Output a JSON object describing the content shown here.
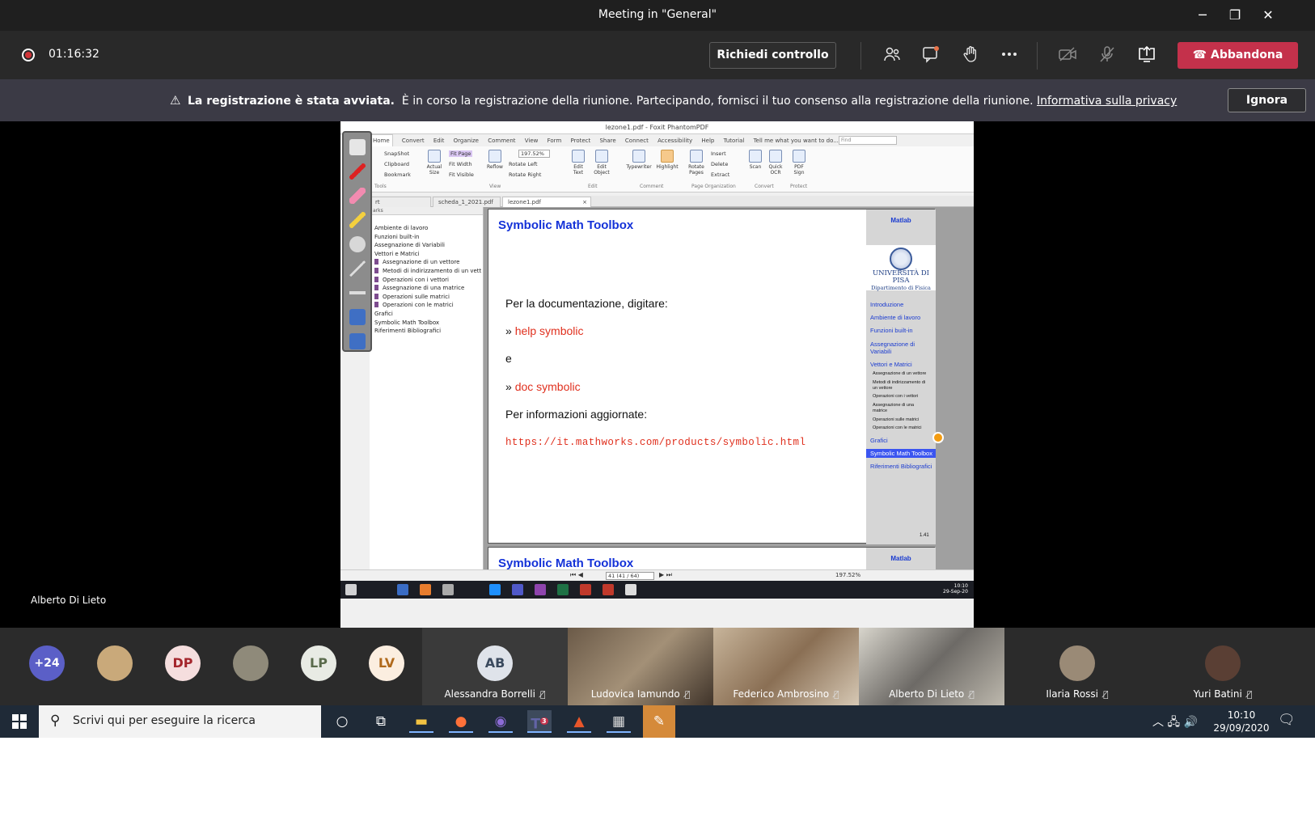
{
  "window": {
    "title": "Meeting in \"General\"",
    "minimize": "─",
    "maximize": "❐",
    "close": "✕"
  },
  "callbar": {
    "timer": "01:16:32",
    "request_control": "Richiedi controllo",
    "leave": "Abbandona"
  },
  "banner": {
    "bold": "La registrazione è stata avviata.",
    "text": "È in corso la registrazione della riunione. Partecipando, fornisci il tuo consenso alla registrazione della riunione.",
    "link": "Informativa sulla privacy",
    "dismiss": "Ignora"
  },
  "stage": {
    "presenter_name": "Alberto Di Lieto"
  },
  "pdf_app": {
    "title": "lezone1.pdf - Foxit PhantomPDF",
    "tabs": [
      "Home",
      "Convert",
      "Edit",
      "Organize",
      "Comment",
      "View",
      "Form",
      "Protect",
      "Share",
      "Connect",
      "Accessibility",
      "Help",
      "Tutorial",
      "Tell me what you want to do..."
    ],
    "find_placeholder": "Find",
    "ribbon_small": {
      "snapshot": "SnapShot",
      "clipboard": "Clipboard",
      "bookmark": "Bookmark",
      "fit_page": "Fit Page",
      "fit_width": "Fit Width",
      "fit_visible": "Fit Visible",
      "zoom": "197.52%",
      "rotate_left": "Rotate Left",
      "rotate_right": "Rotate Right",
      "insert": "Insert",
      "delete": "Delete",
      "extract": "Extract"
    },
    "ribbon_buttons": {
      "actual_size": "Actual Size",
      "reflow": "Reflow",
      "edit_text": "Edit Text",
      "edit_object": "Edit Object",
      "typewriter": "Typewriter",
      "highlight": "Highlight",
      "rotate_pages": "Rotate Pages",
      "scan": "Scan",
      "quick_ocr": "Quick OCR",
      "pdf_sign": "PDF Sign"
    },
    "ribbon_groups": {
      "tools": "Tools",
      "view": "View",
      "edit": "Edit",
      "comment": "Comment",
      "page_org": "Page Organization",
      "convert": "Convert",
      "protect": "Protect"
    },
    "doc_tabs": [
      "rt",
      "scheda_1_2021.pdf",
      "lezone1.pdf"
    ],
    "bookmarks_header": "arks",
    "bookmarks": [
      {
        "label": "Ambiente di lavoro",
        "sub": false
      },
      {
        "label": "Funzioni built-in",
        "sub": false
      },
      {
        "label": "Assegnazione di Variabili",
        "sub": false
      },
      {
        "label": "Vettori e Matrici",
        "sub": false
      },
      {
        "label": "Assegnazione di un vettore",
        "sub": true
      },
      {
        "label": "Metodi di indirizzamento di un vett",
        "sub": true
      },
      {
        "label": "Operazioni con i vettori",
        "sub": true
      },
      {
        "label": "Assegnazione di una matrice",
        "sub": true
      },
      {
        "label": "Operazioni sulle matrici",
        "sub": true
      },
      {
        "label": "Operazioni con le matrici",
        "sub": true
      },
      {
        "label": "Grafici",
        "sub": false
      },
      {
        "label": "Symbolic Math Toolbox",
        "sub": false
      },
      {
        "label": "Riferimenti Bibliografici",
        "sub": false
      }
    ],
    "page": {
      "title": "Symbolic Math Toolbox",
      "line1": "Per la documentazione, digitare:",
      "bullet": "»",
      "cmd1": "help symbolic",
      "conj": "e",
      "cmd2": "doc symbolic",
      "line2": "Per informazioni aggiornate:",
      "url": "https://it.mathworks.com/products/symbolic.html",
      "page_number": "1.41"
    },
    "side_nav": {
      "header": "Matlab",
      "university": "UNIVERSITÀ DI PISA",
      "department": "Dipartimento di Fisica",
      "items": [
        "Introduzione",
        "Ambiente di lavoro",
        "Funzioni built-in",
        "Assegnazione di",
        "Variabili",
        "Vettori e Matrici"
      ],
      "subitems": [
        "Assegnazione di un vettore",
        "Metodi di indirizzamento di",
        "un vettore",
        "Operazioni con i vettori",
        "Assegnazione di una",
        "matrice",
        "Operazioni sulle matrici",
        "Operazioni con le matrici"
      ],
      "after": [
        "Grafici",
        "Symbolic Math Toolbox",
        "Riferimenti Bibliografici"
      ]
    },
    "status": {
      "page_input": "41 (41 / 64)",
      "zoom": "197.52%"
    },
    "taskbar_clock": {
      "time": "10:10",
      "date": "29-Sep-20"
    }
  },
  "participants": {
    "overflow": "+24",
    "initials": [
      "DP",
      "LP",
      "LV"
    ],
    "tiles": [
      {
        "initials": "AB",
        "name": "Alessandra Borrelli"
      },
      {
        "name": "Ludovica Iamundo"
      },
      {
        "name": "Federico Ambrosino"
      },
      {
        "name": "Alberto Di Lieto"
      },
      {
        "name": "Ilaria Rossi"
      },
      {
        "name": "Yuri Batini"
      }
    ]
  },
  "taskbar": {
    "search_placeholder": "Scrivi qui per eseguire la ricerca",
    "teams_badge": "3",
    "time": "10:10",
    "date": "29/09/2020"
  }
}
